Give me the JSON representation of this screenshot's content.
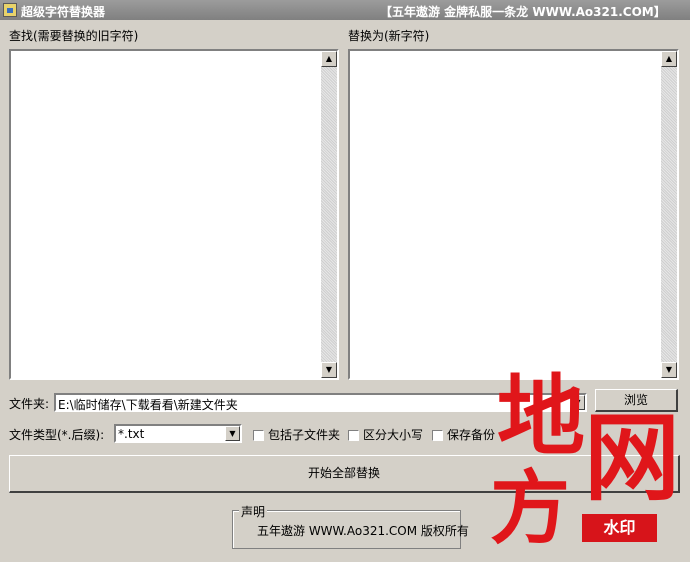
{
  "window": {
    "title": "超级字符替换器",
    "banner": "【五年遨游 金牌私服一条龙 WWW.Ao321.COM】"
  },
  "find": {
    "label": "查找(需要替换的旧字符)",
    "value": ""
  },
  "replace": {
    "label": "替换为(新字符)",
    "value": ""
  },
  "folder": {
    "label": "文件夹:",
    "value": "E:\\临时储存\\下载看看\\新建文件夹",
    "browse_label": "浏览"
  },
  "filetype": {
    "label": "文件类型(*.后缀):",
    "value": "*.txt"
  },
  "options": [
    {
      "label": "包括子文件夹",
      "checked": false
    },
    {
      "label": "区分大小写",
      "checked": false
    },
    {
      "label": "保存备份",
      "checked": false
    }
  ],
  "start_button": "开始全部替换",
  "statement": {
    "title": "声明",
    "text": "五年遨游 WWW.Ao321.COM 版权所有"
  },
  "watermark": {
    "chars": [
      "地",
      "网",
      "方"
    ],
    "badge": "水印",
    "color": "#e0161a"
  },
  "icons": {
    "scroll_up": "▲",
    "scroll_down": "▼",
    "dropdown": "▼"
  }
}
